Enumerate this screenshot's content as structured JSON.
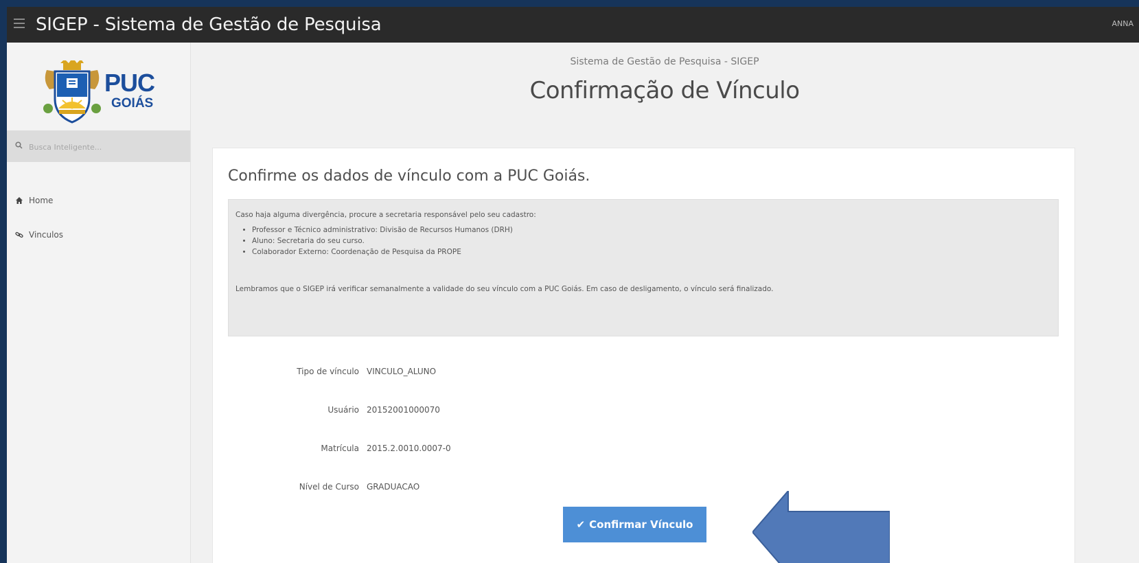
{
  "topbar": {
    "title": "SIGEP - Sistema de Gestão de Pesquisa",
    "user": "ANNA"
  },
  "sidebar": {
    "logo": {
      "line1": "PUC",
      "line2": "GOIÁS"
    },
    "search_placeholder": "Busca Inteligente...",
    "items": [
      {
        "label": "Home",
        "icon": "home-icon"
      },
      {
        "label": "Vinculos",
        "icon": "link-icon"
      }
    ]
  },
  "header": {
    "subtitle": "Sistema de Gestão de Pesquisa - SIGEP",
    "title": "Confirmação de Vínculo"
  },
  "panel": {
    "heading": "Confirme os dados de vínculo com a PUC Goiás.",
    "notice": {
      "intro": "Caso haja alguma divergência, procure a secretaria responsável pelo seu cadastro:",
      "items": [
        "Professor e Técnico administrativo: Divisão de Recursos Humanos (DRH)",
        "Aluno: Secretaria do seu curso.",
        "Colaborador Externo: Coordenação de Pesquisa da PROPE"
      ],
      "outro": "Lembramos que o SIGEP irá verificar semanalmente a validade do seu vínculo com a PUC Goiás. Em caso de desligamento, o vínculo será finalizado."
    },
    "fields": [
      {
        "label": "Tipo de vínculo",
        "value": "VINCULO_ALUNO"
      },
      {
        "label": "Usuário",
        "value": "20152001000070"
      },
      {
        "label": "Matrícula",
        "value": "2015.2.0010.0007-0"
      },
      {
        "label": "Nível de Curso",
        "value": "GRADUACAO"
      }
    ],
    "confirm_label": "Confirmar Vínculo"
  },
  "colors": {
    "topbar": "#2a2a2a",
    "button": "#4d8fd6",
    "arrow": "#5179b8",
    "frame": "#16345a",
    "logo_text": "#1c4e9c"
  }
}
